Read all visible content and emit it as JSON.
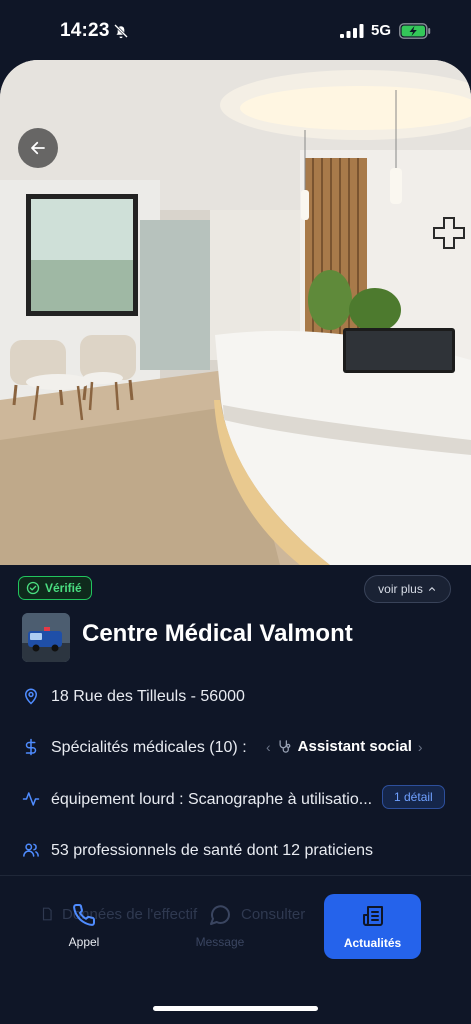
{
  "status_bar": {
    "time": "14:23",
    "network": "5G"
  },
  "hero": {
    "image_alt": "reception-area-photo"
  },
  "badges": {
    "verified": "Vérifié",
    "see_more": "voir plus"
  },
  "center": {
    "name": "Centre Médical Valmont"
  },
  "info": {
    "address": "18 Rue des Tilleuls - 56000",
    "specialties_label": "Spécialités médicales (10) :",
    "specialty_selected": "Assistant social",
    "equipment": "équipement lourd : Scanographe à utilisatio...",
    "equipment_badge": "1 détail",
    "staff": "53 professionnels de santé dont 12 praticiens"
  },
  "ghost_actions": {
    "staff_data": "Données de l'effectif",
    "consult": "Consulter"
  },
  "bottom_nav": [
    {
      "label": "Appel",
      "icon": "phone-icon"
    },
    {
      "label": "Message",
      "icon": "message-icon"
    },
    {
      "label": "Actualités",
      "icon": "newspaper-icon"
    }
  ],
  "colors": {
    "background": "#0f1627",
    "accent": "#2563eb",
    "verified": "#22c55e",
    "icon_blue": "#4f8cff"
  }
}
